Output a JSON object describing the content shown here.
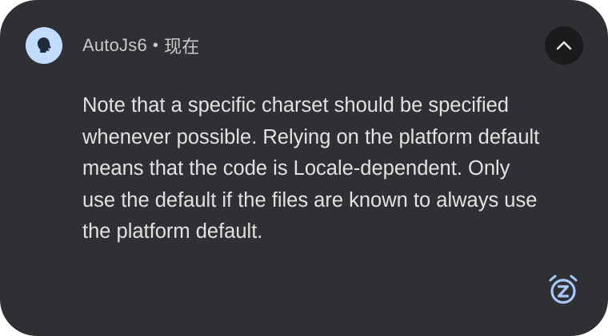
{
  "notification": {
    "app_name": "AutoJs6",
    "separator": "•",
    "time": "现在",
    "message": "Note that a specific charset should be specified\nwhenever possible. Relying on the platform default\nmeans that the code is Locale-dependent. Only\nuse the default if the files are known to always use\nthe platform default.",
    "app_icon": "autojs6-app-icon",
    "expand_icon": "chevron-up-icon",
    "snooze_icon": "snooze-icon"
  },
  "colors": {
    "card_background": "#2f3033",
    "icon_background": "#c2dcff",
    "expand_button_background": "#1b1b1d",
    "accent": "#a8c7fa",
    "text": "#e2e2e2"
  }
}
